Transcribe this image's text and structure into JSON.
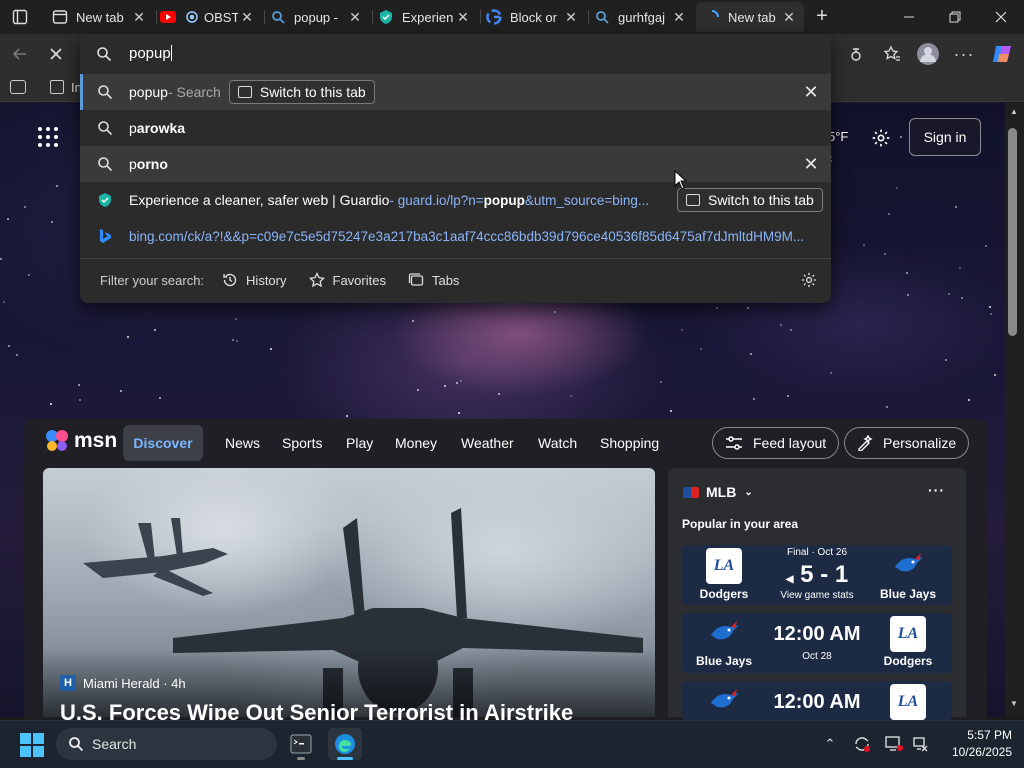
{
  "tabs": [
    {
      "title": "New tab",
      "icon": "newtab-icon"
    },
    {
      "title": "OBST",
      "icon": "youtube-icon"
    },
    {
      "title": "popup -",
      "icon": "search-icon"
    },
    {
      "title": "Experien",
      "icon": "guardio-icon"
    },
    {
      "title": "Block or",
      "icon": "google-icon"
    },
    {
      "title": "gurhfgaj",
      "icon": "search-icon"
    },
    {
      "title": "New tab",
      "icon": "loading-icon"
    }
  ],
  "omnibox": {
    "query": "popup",
    "suggestions": [
      {
        "bold": "popup",
        "rest": " - Search",
        "switch_label": "Switch to this tab"
      },
      {
        "bold_prefix": "p",
        "text": "arowka"
      },
      {
        "bold_prefix": "p",
        "text": "orno"
      },
      {
        "title": "Experience a cleaner, safer web | Guardio",
        "url_pre": " - guard.io/lp?n=",
        "url_bold": "popup",
        "url_post": "&utm_source=bing...",
        "switch_label": "Switch to this tab"
      },
      {
        "url": "bing.com/ck/a?!&&p=c09e7c5e5d75247e3a217ba3c1aaf74ccc86bdb39d796ce40536f85d6475af7dJmltdHM9M..."
      }
    ],
    "filter_label": "Filter your search:",
    "filters": [
      "History",
      "Favorites",
      "Tabs"
    ]
  },
  "favbar": {
    "item": "In"
  },
  "newtab": {
    "weather_temp": "5°F",
    "sign_in": "Sign in",
    "msn": {
      "logo": "msn",
      "nav": [
        "Discover",
        "News",
        "Sports",
        "Play",
        "Money",
        "Weather",
        "Watch",
        "Shopping"
      ],
      "feed_layout": "Feed layout",
      "personalize": "Personalize"
    },
    "hero": {
      "source": "Miami Herald",
      "source_initial": "H",
      "age": "4h",
      "title": "U.S. Forces Wipe Out Senior Terrorist in Airstrike"
    },
    "sports": {
      "league": "MLB",
      "more": "···",
      "popular": "Popular in your area",
      "games": [
        {
          "home": "Dodgers",
          "away": "Blue Jays",
          "status": "Final · Oct 26",
          "score": "5 - 1",
          "sub": "View game stats",
          "home_logo": "LA",
          "away_logo": "bluejays"
        },
        {
          "home": "Blue Jays",
          "away": "Dodgers",
          "time": "12:00 AM",
          "sub": "Oct 28",
          "home_logo": "bluejays",
          "away_logo": "LA"
        },
        {
          "time": "12:00 AM",
          "home_logo": "bluejays",
          "away_logo": "LA"
        }
      ]
    }
  },
  "taskbar": {
    "search": "Search",
    "time": "5:57 PM",
    "date": "10/26/2025"
  },
  "colors": {
    "accent": "#5b9bd5",
    "msn_discover": "#7ab7ff",
    "link": "#8ab4f8"
  }
}
